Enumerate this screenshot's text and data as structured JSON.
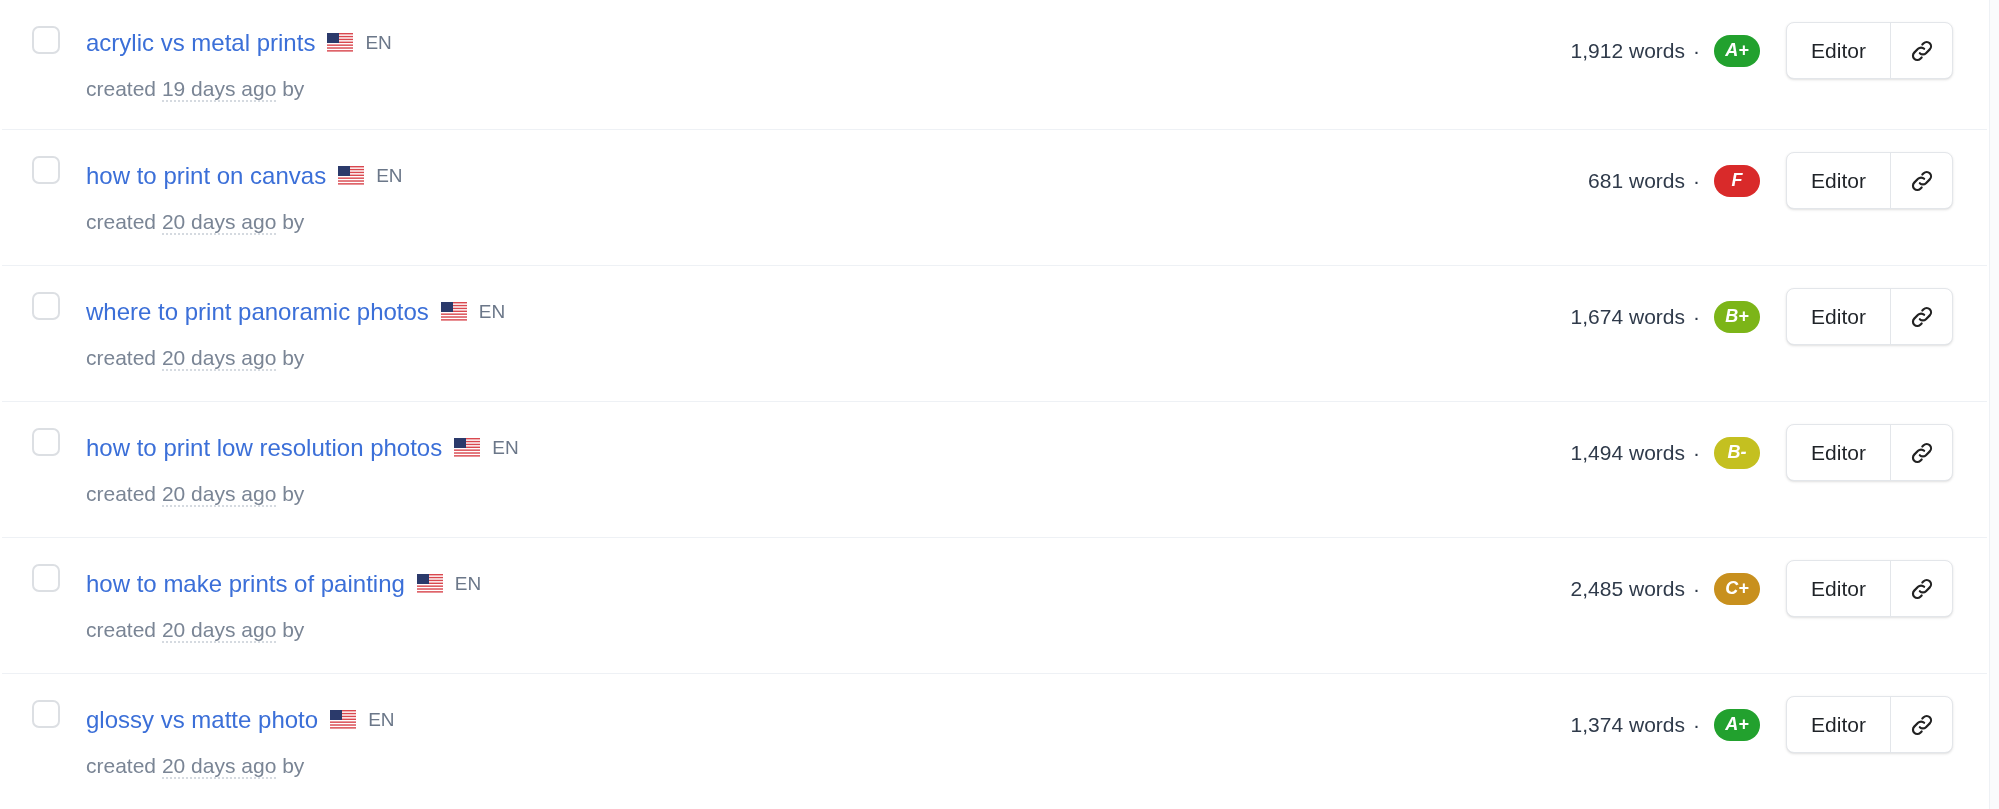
{
  "articles": [
    {
      "checked": false,
      "title": "acrylic vs metal prints",
      "language": "EN",
      "created": {
        "prefix": "created",
        "time": "19 days ago",
        "suffix": "by"
      },
      "word_count": "1,912 words",
      "separator": "·",
      "grade": {
        "label": "A+",
        "color": "#22a12e"
      },
      "editor_button": "Editor"
    },
    {
      "checked": false,
      "title": "how to print on canvas",
      "language": "EN",
      "created": {
        "prefix": "created",
        "time": "20 days ago",
        "suffix": "by"
      },
      "word_count": "681 words",
      "separator": "·",
      "grade": {
        "label": "F",
        "color": "#d92a2a"
      },
      "editor_button": "Editor"
    },
    {
      "checked": false,
      "title": "where to print panoramic photos",
      "language": "EN",
      "created": {
        "prefix": "created",
        "time": "20 days ago",
        "suffix": "by"
      },
      "word_count": "1,674 words",
      "separator": "·",
      "grade": {
        "label": "B+",
        "color": "#7cb518"
      },
      "editor_button": "Editor"
    },
    {
      "checked": false,
      "title": "how to print low resolution photos",
      "language": "EN",
      "created": {
        "prefix": "created",
        "time": "20 days ago",
        "suffix": "by"
      },
      "word_count": "1,494 words",
      "separator": "·",
      "grade": {
        "label": "B-",
        "color": "#c4c020"
      },
      "editor_button": "Editor"
    },
    {
      "checked": false,
      "title": "how to make prints of painting",
      "language": "EN",
      "created": {
        "prefix": "created",
        "time": "20 days ago",
        "suffix": "by"
      },
      "word_count": "2,485 words",
      "separator": "·",
      "grade": {
        "label": "C+",
        "color": "#c8901e"
      },
      "editor_button": "Editor"
    },
    {
      "checked": false,
      "title": "glossy vs matte photo",
      "language": "EN",
      "created": {
        "prefix": "created",
        "time": "20 days ago",
        "suffix": "by"
      },
      "word_count": "1,374 words",
      "separator": "·",
      "grade": {
        "label": "A+",
        "color": "#22a12e"
      },
      "editor_button": "Editor"
    }
  ]
}
